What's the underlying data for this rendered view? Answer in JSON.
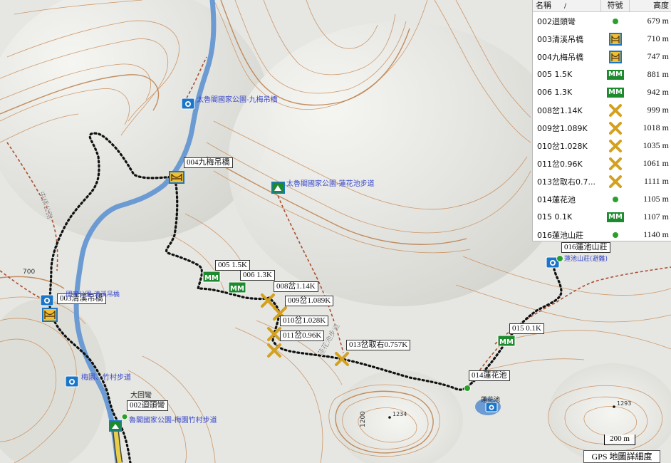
{
  "waypoint_labels": {
    "w002": "002迴頭彎",
    "w003": "003清溪吊橋",
    "w004": "004九梅吊橋",
    "w005": "005 1.5K",
    "w006": "006 1.3K",
    "w008": "008岔1.14K",
    "w009": "009岔1.089K",
    "w010": "010岔1.028K",
    "w011": "011岔0.96K",
    "w013": "013岔取右0.757K",
    "w014": "014蓮花池",
    "w015": "015 0.1K",
    "w016": "016蓮池山莊"
  },
  "poi_labels": {
    "jiumei": "太魯閣國家公園-九梅吊橋",
    "lianhua_trail": "太魯閣國家公園-蓮花池步道",
    "qingxi": "...國家公園-清溪吊橋",
    "meiyuan": "梅園、竹村步道",
    "meiyuan_trail": "魯閣國家公園-梅園竹村步道",
    "dawan": "大回彎",
    "lianchi_hut": "蓮池山莊(避難)",
    "lianhua_pond": "蓮花池",
    "road_vertical": "中横公路",
    "trail_vertical": "蓮花池步道"
  },
  "elevation_labels": {
    "c700": "700",
    "c1200": "1200",
    "p1234": "1234",
    "p1293": "1293"
  },
  "panel": {
    "headers": {
      "name": "名稱",
      "symbol": "符號",
      "altitude": "高度"
    },
    "rows": [
      {
        "name": "002迴頭彎",
        "symbol": "dot",
        "alt": "679 m"
      },
      {
        "name": "003清溪吊橋",
        "symbol": "bridge",
        "alt": "710 m"
      },
      {
        "name": "004九梅吊橋",
        "symbol": "bridge",
        "alt": "747 m"
      },
      {
        "name": "005 1.5K",
        "symbol": "mm",
        "alt": "881 m"
      },
      {
        "name": "006 1.3K",
        "symbol": "mm",
        "alt": "942 m"
      },
      {
        "name": "008岔1.14K",
        "symbol": "cross",
        "alt": "999 m"
      },
      {
        "name": "009岔1.089K",
        "symbol": "cross",
        "alt": "1018 m"
      },
      {
        "name": "010岔1.028K",
        "symbol": "cross",
        "alt": "1035 m"
      },
      {
        "name": "011岔0.96K",
        "symbol": "cross",
        "alt": "1061 m"
      },
      {
        "name": "013岔取右0.7...",
        "symbol": "cross",
        "alt": "1111 m"
      },
      {
        "name": "014蓮花池",
        "symbol": "dot",
        "alt": "1105 m"
      },
      {
        "name": "015 0.1K",
        "symbol": "mm",
        "alt": "1107 m"
      },
      {
        "name": "016蓮池山莊",
        "symbol": "dot",
        "alt": "1140 m"
      }
    ]
  },
  "scale_label": "200 m",
  "detail_label": "GPS 地圖詳細度",
  "colors": {
    "river": "#6b9bd2",
    "track": "#000000",
    "trail": "#a85030",
    "mm_green": "#1d8a2e",
    "cross_gold": "#d4a020",
    "poi_blue": "#3a49c9"
  }
}
